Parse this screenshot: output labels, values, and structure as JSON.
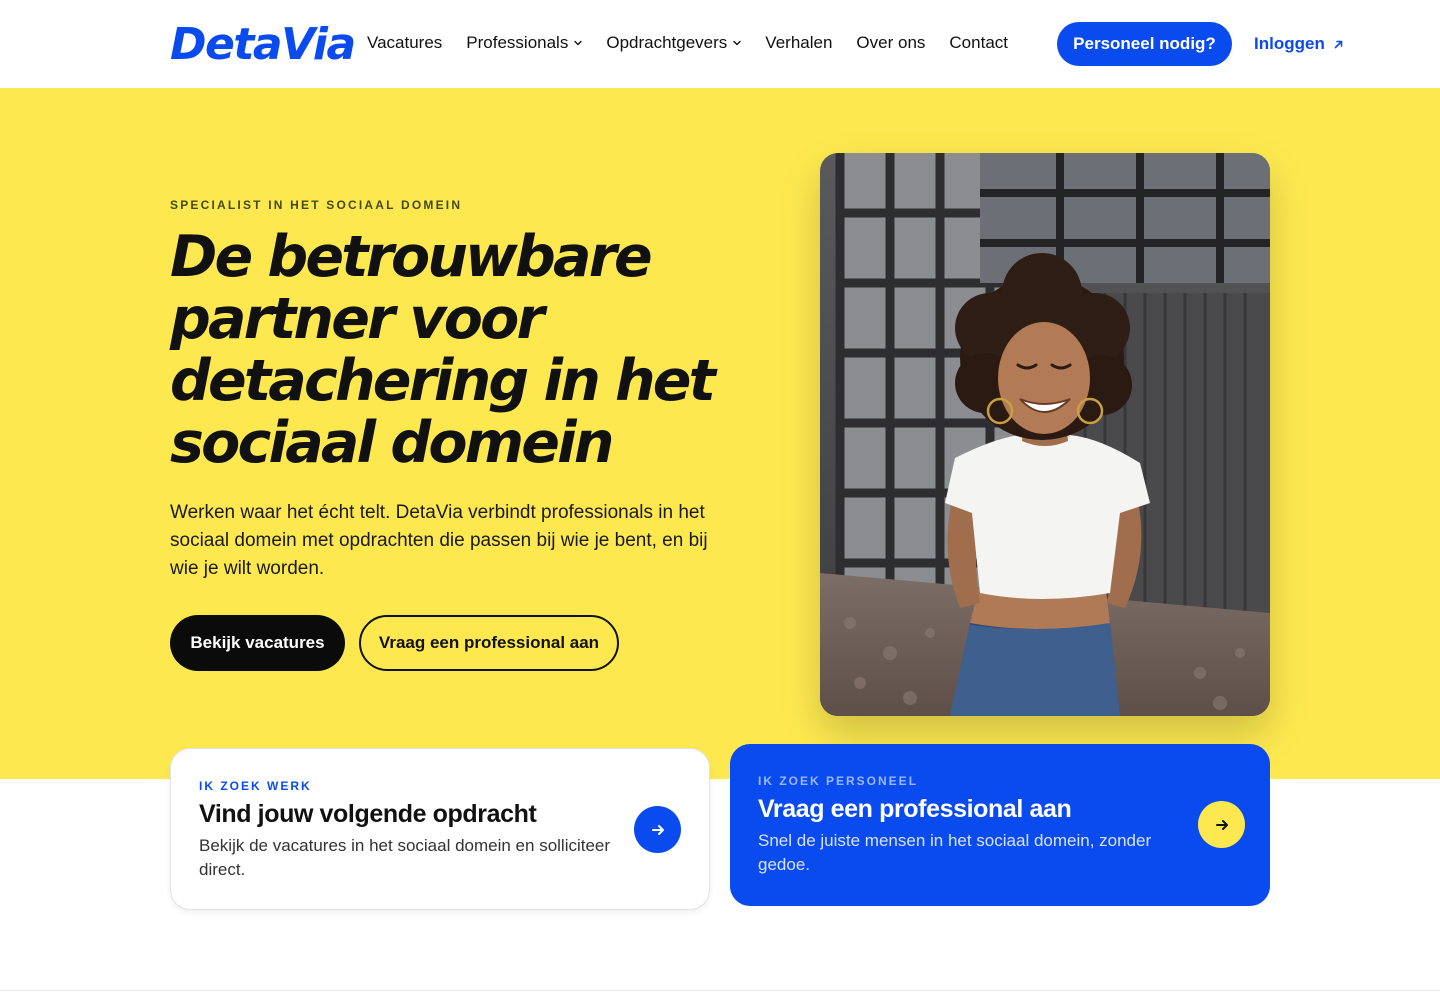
{
  "brand": {
    "logo_text": "DetaVia",
    "accent": "#0a4bf0",
    "yellow": "#fde94f"
  },
  "nav": {
    "items": [
      {
        "label": "Vacatures",
        "dropdown": false
      },
      {
        "label": "Professionals",
        "dropdown": true
      },
      {
        "label": "Opdrachtgevers",
        "dropdown": true
      },
      {
        "label": "Verhalen",
        "dropdown": false
      },
      {
        "label": "Over ons",
        "dropdown": false
      },
      {
        "label": "Contact",
        "dropdown": false
      }
    ],
    "cta_label": "Personeel nodig?",
    "login_label": "Inloggen",
    "login_icon": "arrow-up-right-icon"
  },
  "hero": {
    "eyebrow": "SPECIALIST IN HET SOCIAAL DOMEIN",
    "headline_lines": [
      "De betrouwbare",
      "partner voor",
      "detachering in het",
      "sociaal domein"
    ],
    "lead": "Werken waar het écht telt. DetaVia verbindt professionals in het sociaal domein met opdrachten die passen bij wie je bent, en bij wie je wilt worden.",
    "primary_button": "Bekijk vacatures",
    "secondary_button": "Vraag een professional aan",
    "photo_description": "smiling woman photo"
  },
  "cards": {
    "work": {
      "eyebrow": "IK ZOEK WERK",
      "title": "Vind jouw volgende opdracht",
      "text": "Bekijk de vacatures in het sociaal domein en solliciteer direct.",
      "icon": "arrow-right-icon"
    },
    "staff": {
      "eyebrow": "IK ZOEK PERSONEEL",
      "title": "Vraag een professional aan",
      "text": "Snel de juiste mensen in het sociaal domein, zonder gedoe.",
      "icon": "arrow-right-icon"
    }
  }
}
